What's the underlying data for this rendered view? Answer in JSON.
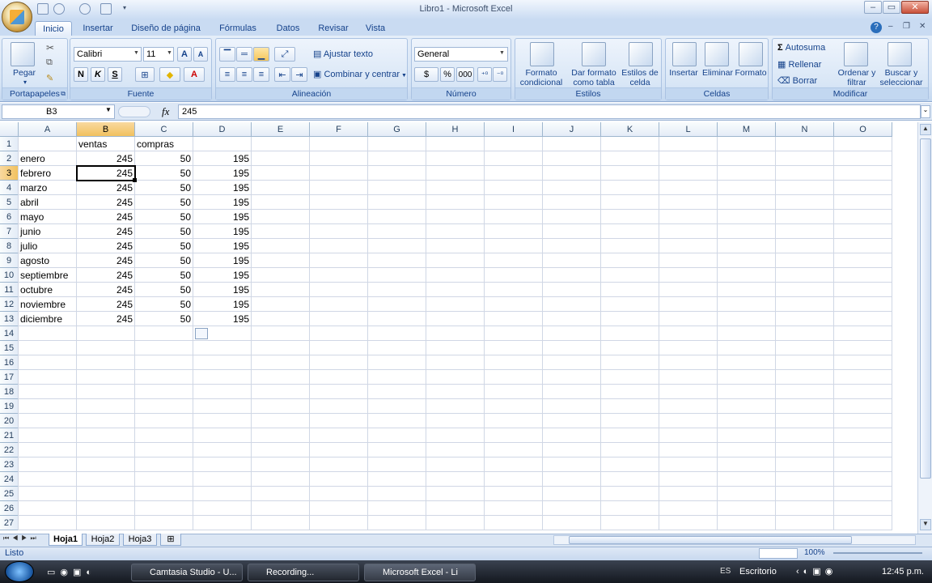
{
  "window": {
    "title": "Libro1 - Microsoft Excel",
    "min": "–",
    "max": "▭",
    "close": "✕"
  },
  "tabs": [
    "Inicio",
    "Insertar",
    "Diseño de página",
    "Fórmulas",
    "Datos",
    "Revisar",
    "Vista"
  ],
  "ribbon": {
    "portapapeles": {
      "label": "Portapapeles",
      "paste": "Pegar"
    },
    "fuente": {
      "label": "Fuente",
      "font": "Calibri",
      "size": "11",
      "bold": "N",
      "italic": "K",
      "underline": "S",
      "grow": "A",
      "shrink": "A"
    },
    "alineacion": {
      "label": "Alineación",
      "wrap": "Ajustar texto",
      "merge": "Combinar y centrar"
    },
    "numero": {
      "label": "Número",
      "format": "General",
      "currency": "$",
      "percent": "%",
      "thousands": "000"
    },
    "estilos": {
      "label": "Estilos",
      "conditional": "Formato condicional",
      "table": "Dar formato como tabla",
      "cell": "Estilos de celda"
    },
    "celdas": {
      "label": "Celdas",
      "insert": "Insertar",
      "delete": "Eliminar",
      "format": "Formato"
    },
    "modificar": {
      "label": "Modificar",
      "autosum": "Autosuma",
      "fill": "Rellenar",
      "clear": "Borrar",
      "sort": "Ordenar y filtrar",
      "find": "Buscar y seleccionar"
    }
  },
  "formula_bar": {
    "name_box": "B3",
    "fx": "fx",
    "value": "245"
  },
  "columns": [
    "A",
    "B",
    "C",
    "D",
    "E",
    "F",
    "G",
    "H",
    "I",
    "J",
    "K",
    "L",
    "M",
    "N",
    "O"
  ],
  "rows": [
    "1",
    "2",
    "3",
    "4",
    "5",
    "6",
    "7",
    "8",
    "9",
    "10",
    "11",
    "12",
    "13",
    "14",
    "15",
    "16",
    "17",
    "18",
    "19",
    "20",
    "21",
    "22",
    "23",
    "24",
    "25",
    "26",
    "27"
  ],
  "headers": {
    "B": "ventas",
    "C": "compras"
  },
  "data": [
    {
      "A": "enero",
      "B": "245",
      "C": "50",
      "D": "195"
    },
    {
      "A": "febrero",
      "B": "245",
      "C": "50",
      "D": "195"
    },
    {
      "A": "marzo",
      "B": "245",
      "C": "50",
      "D": "195"
    },
    {
      "A": "abril",
      "B": "245",
      "C": "50",
      "D": "195"
    },
    {
      "A": "mayo",
      "B": "245",
      "C": "50",
      "D": "195"
    },
    {
      "A": "junio",
      "B": "245",
      "C": "50",
      "D": "195"
    },
    {
      "A": "julio",
      "B": "245",
      "C": "50",
      "D": "195"
    },
    {
      "A": "agosto",
      "B": "245",
      "C": "50",
      "D": "195"
    },
    {
      "A": "septiembre",
      "B": "245",
      "C": "50",
      "D": "195"
    },
    {
      "A": "octubre",
      "B": "245",
      "C": "50",
      "D": "195"
    },
    {
      "A": "noviembre",
      "B": "245",
      "C": "50",
      "D": "195"
    },
    {
      "A": "diciembre",
      "B": "245",
      "C": "50",
      "D": "195"
    }
  ],
  "sheets": [
    "Hoja1",
    "Hoja2",
    "Hoja3"
  ],
  "status": {
    "ready": "Listo",
    "zoom": "100%"
  },
  "taskbar": {
    "items": [
      "Camtasia Studio - U...",
      "Recording...",
      "Microsoft Excel - Li"
    ],
    "lang": "ES",
    "desktop": "Escritorio",
    "time": "12:45 p.m."
  }
}
